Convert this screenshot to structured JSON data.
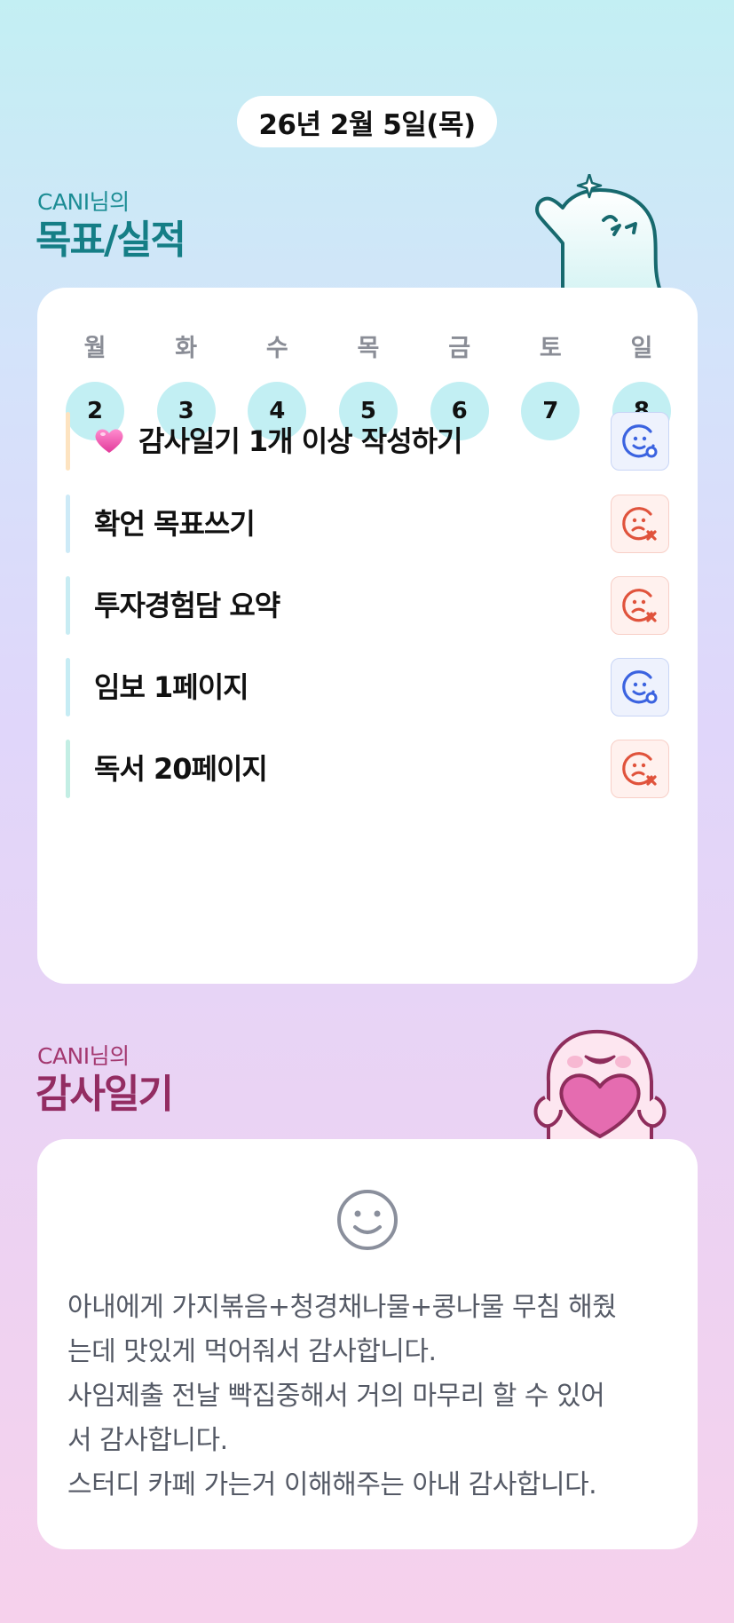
{
  "header": {
    "date": "26년 2월 5일(목)"
  },
  "goals_section": {
    "subtitle": "CANI님의",
    "title": "목표/실적",
    "week": [
      {
        "day": "월",
        "date": "2"
      },
      {
        "day": "화",
        "date": "3"
      },
      {
        "day": "수",
        "date": "4"
      },
      {
        "day": "목",
        "date": "5"
      },
      {
        "day": "금",
        "date": "6"
      },
      {
        "day": "토",
        "date": "7"
      },
      {
        "day": "일",
        "date": "8"
      }
    ],
    "goals": [
      {
        "label": "감사일기 1개 이상 작성하기",
        "status": "done",
        "icon": "heart-icon",
        "bar_color": "#fde3c0"
      },
      {
        "label": "확언 목표쓰기",
        "status": "fail",
        "bar_color": "#cdeaf7"
      },
      {
        "label": "투자경험담 요약",
        "status": "fail",
        "bar_color": "#c8ecf3"
      },
      {
        "label": "임보 1페이지",
        "status": "done",
        "bar_color": "#c6ecf4"
      },
      {
        "label": "독서 20페이지",
        "status": "fail",
        "bar_color": "#c3eee4"
      }
    ]
  },
  "diary_section": {
    "subtitle": "CANI님의",
    "title": "감사일기",
    "lines": [
      "아내에게 가지볶음+청경채나물+콩나물 무침 해줬",
      "는데 맛있게 먹어줘서 감사합니다.",
      "사임제출 전날 빡집중해서 거의 마무리 할 수 있어",
      "서 감사합니다.",
      "스터디 카페 가는거 이해해주는 아내 감사합니다."
    ]
  },
  "colors": {
    "done": "#3b63e0",
    "fail": "#e0533c",
    "day_circle": "#c2eff3",
    "goal_title": "#157e86",
    "diary_title": "#932c62"
  }
}
